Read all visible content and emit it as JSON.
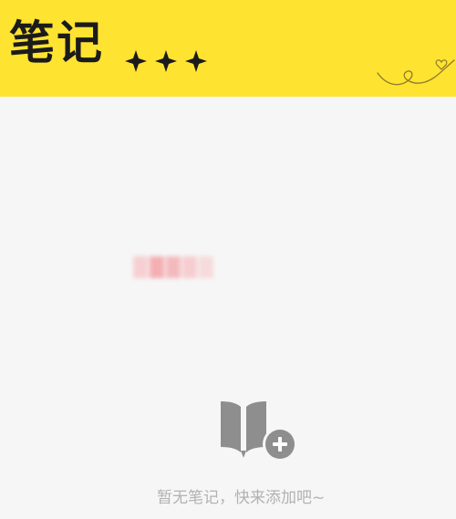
{
  "header": {
    "title": "笔记",
    "decoration": "sparkle-stars"
  },
  "colors": {
    "header_bg": "#ffe331",
    "page_bg": "#f6f6f6",
    "icon_gray": "#8e8e8e",
    "text_muted": "#b2b2b2",
    "blur_pink": "#f4a3a8"
  },
  "empty_state": {
    "icon": "book-add-icon",
    "message": "暂无笔记，快来添加吧~"
  }
}
